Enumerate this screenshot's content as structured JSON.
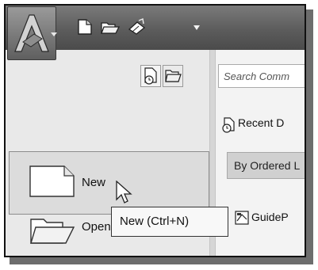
{
  "quick_access": {
    "icons": [
      "new-file-icon",
      "open-folder-icon",
      "save-icon",
      "dropdown-arrow-icon"
    ]
  },
  "app_menu": {
    "search_placeholder": "Search Comm",
    "recent_label": "Recent D",
    "ordered_list_value": "By Ordered L",
    "recent_files": [
      {
        "name": "GuideP"
      }
    ],
    "menu_items": [
      {
        "label": "New"
      },
      {
        "label": "Open"
      }
    ],
    "tooltip": "New (Ctrl+N)"
  }
}
